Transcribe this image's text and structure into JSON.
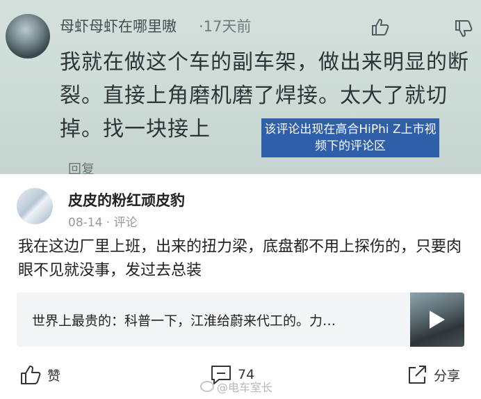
{
  "photo_comment": {
    "username": "母虾母虾在哪里嗷",
    "time": "·17天前",
    "text": "我就在做这个车的副车架，做出来明显的断裂。直接上角磨机磨了焊接。太大了就切掉。找一块接上",
    "reply_label": "回复",
    "annotation": "该评论出现在高合HiPhi Z上市视频下的评论区"
  },
  "comment": {
    "username": "皮皮的粉红顽皮豹",
    "date": "08-14",
    "meta_suffix": " · 评论",
    "text": "我在这边厂里上班，出来的扭力梁，底盘都不用上探伤的，只要肉眼不见就没事，发过去总装"
  },
  "card": {
    "title": "世界上最贵的：科普一下，江淮给蔚来代工的。力…"
  },
  "actions": {
    "like_label": "赞",
    "comment_count": "74",
    "share_label": "分享"
  },
  "watermark": {
    "text": "@电车室长"
  }
}
